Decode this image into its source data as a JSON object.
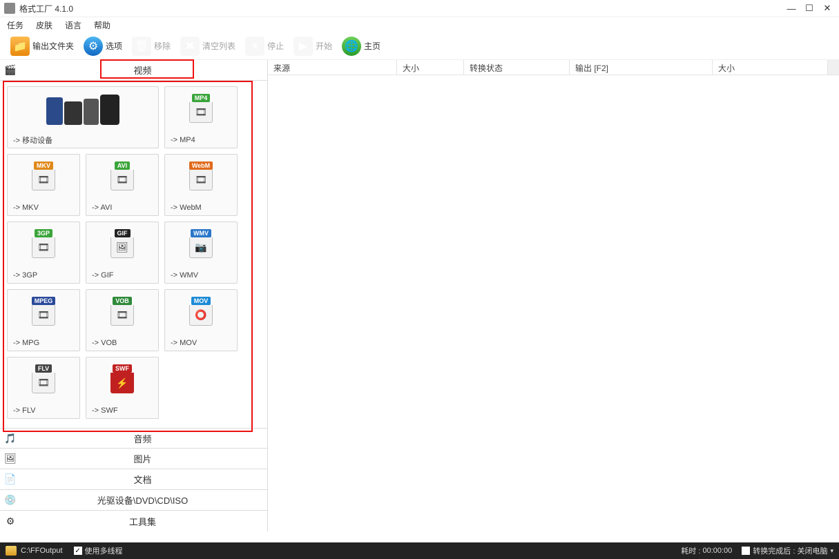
{
  "window": {
    "title": "格式工厂 4.1.0"
  },
  "menu": {
    "tasks": "任务",
    "skin": "皮肤",
    "language": "语言",
    "help": "帮助"
  },
  "toolbar": {
    "output_folder": "输出文件夹",
    "options": "选项",
    "remove": "移除",
    "clear_list": "清空列表",
    "stop": "停止",
    "start": "开始",
    "home": "主页"
  },
  "categories": {
    "video": "视频",
    "audio": "音频",
    "picture": "图片",
    "document": "文档",
    "disc": "光驱设备\\DVD\\CD\\ISO",
    "tools": "工具集"
  },
  "formats": [
    {
      "label": "-> 移动设备",
      "badge": "",
      "color": "#444",
      "wide": true,
      "icon": "devices"
    },
    {
      "label": "-> MP4",
      "badge": "MP4",
      "color": "#3aa53a",
      "wide": false,
      "icon": "film"
    },
    {
      "label": "-> MKV",
      "badge": "MKV",
      "color": "#e08a1b",
      "wide": false,
      "icon": "film"
    },
    {
      "label": "-> AVI",
      "badge": "AVI",
      "color": "#3aa53a",
      "wide": false,
      "icon": "film"
    },
    {
      "label": "-> WebM",
      "badge": "WebM",
      "color": "#e06a1b",
      "wide": false,
      "icon": "film"
    },
    {
      "label": "-> 3GP",
      "badge": "3GP",
      "color": "#3aa53a",
      "wide": false,
      "icon": "film"
    },
    {
      "label": "-> GIF",
      "badge": "GIF",
      "color": "#222",
      "wide": false,
      "icon": "pic"
    },
    {
      "label": "-> WMV",
      "badge": "WMV",
      "color": "#2a77c9",
      "wide": false,
      "icon": "cam"
    },
    {
      "label": "-> MPG",
      "badge": "MPEG",
      "color": "#2a4a9a",
      "wide": false,
      "icon": "film"
    },
    {
      "label": "-> VOB",
      "badge": "VOB",
      "color": "#2f8a3a",
      "wide": false,
      "icon": "film"
    },
    {
      "label": "-> MOV",
      "badge": "MOV",
      "color": "#1c8ad6",
      "wide": false,
      "icon": "qt"
    },
    {
      "label": "-> FLV",
      "badge": "FLV",
      "color": "#444",
      "wide": false,
      "icon": "film"
    },
    {
      "label": "-> SWF",
      "badge": "SWF",
      "color": "#c12020",
      "wide": false,
      "icon": "flash"
    }
  ],
  "list_columns": {
    "source": "来源",
    "size": "大小",
    "status": "转换状态",
    "output": "输出 [F2]",
    "out_size": "大小"
  },
  "statusbar": {
    "path": "C:\\FFOutput",
    "multithread": "使用多线程",
    "elapsed_label": "耗时 :",
    "elapsed_value": "00:00:00",
    "after_label": "转换完成后 :",
    "after_value": "关闭电脑"
  }
}
